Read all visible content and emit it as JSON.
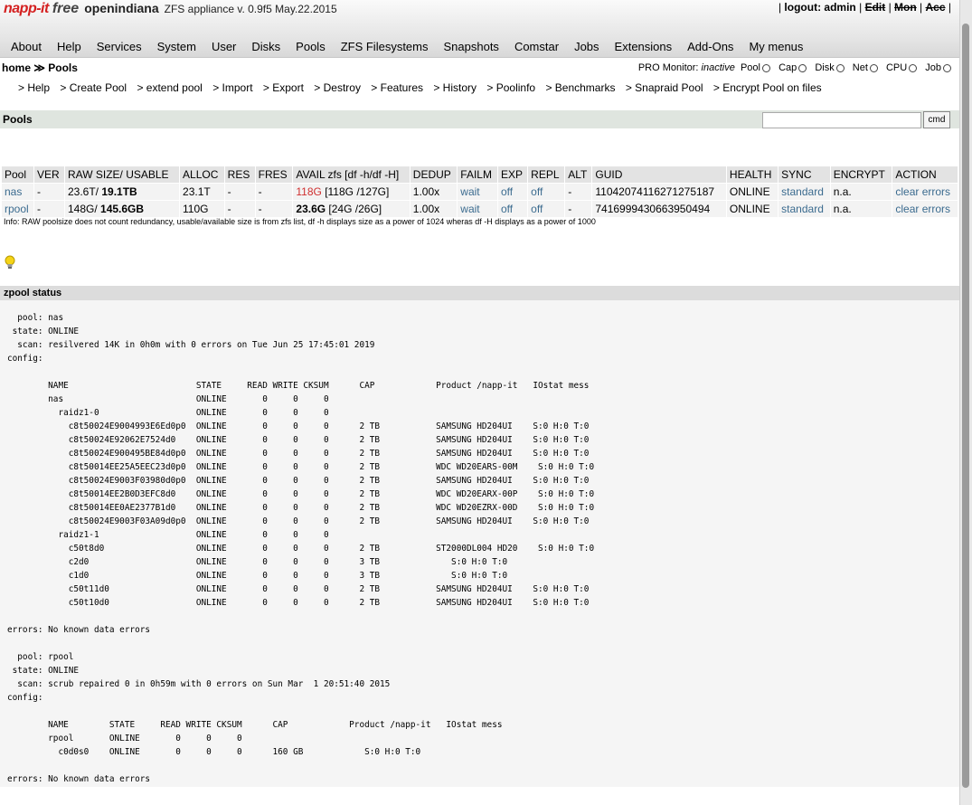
{
  "brand": {
    "logo": "napp-it",
    "free": "free",
    "os": "openindiana",
    "version": "ZFS appliance v. 0.9f5 May.22.2015"
  },
  "userbar": {
    "sep1": "|",
    "logout": "logout: admin",
    "sep2": "|",
    "edit": "Edit",
    "sep3": "|",
    "mon": "Mon",
    "sep4": "|",
    "acc": "Acc",
    "sep5": "|"
  },
  "mainnav": [
    "About",
    "Help",
    "Services",
    "System",
    "User",
    "Disks",
    "Pools",
    "ZFS Filesystems",
    "Snapshots",
    "Comstar",
    "Jobs",
    "Extensions",
    "Add-Ons",
    "My menus"
  ],
  "breadcrumb": "home ≫ Pools",
  "monitor": {
    "label": "PRO Monitor:",
    "state": "inactive",
    "items": [
      "Pool",
      "Cap",
      "Disk",
      "Net",
      "CPU",
      "Job"
    ]
  },
  "subnav": [
    "> Help",
    "> Create Pool",
    "> extend pool",
    "> Import",
    "> Export",
    "> Destroy",
    "> Features",
    "> History",
    "> Poolinfo",
    "> Benchmarks",
    "> Snapraid Pool",
    "> Encrypt Pool on files"
  ],
  "section_pools": "Pools",
  "cmd_label": "cmd",
  "pools_table": {
    "headers": [
      "Pool",
      "VER",
      "RAW SIZE/ USABLE",
      "ALLOC",
      "RES",
      "FRES",
      "AVAIL zfs [df -h/df -H]",
      "DEDUP",
      "FAILM",
      "EXP",
      "REPL",
      "ALT",
      "GUID",
      "HEALTH",
      "SYNC",
      "ENCRYPT",
      "ACTION"
    ],
    "rows": [
      {
        "pool": "nas",
        "ver": "-",
        "raw": "23.6T/ ",
        "usable": "19.1TB",
        "alloc": "23.1T",
        "res": "-",
        "fres": "-",
        "avail": "118G",
        "avail_df": " [118G /127G]",
        "dedup": "1.00x",
        "failm": "wait",
        "exp": "off",
        "repl": "off",
        "alt": "-",
        "guid": "11042074116271275187",
        "health": "ONLINE",
        "sync": "standard",
        "encrypt": "n.a.",
        "action": "clear errors"
      },
      {
        "pool": "rpool",
        "ver": "-",
        "raw": "148G/ ",
        "usable": "145.6GB",
        "alloc": "110G",
        "res": "-",
        "fres": "-",
        "avail": "23.6G",
        "avail_df": " [24G /26G]",
        "dedup": "1.00x",
        "failm": "wait",
        "exp": "off",
        "repl": "off",
        "alt": "-",
        "guid": "7416999430663950494",
        "health": "ONLINE",
        "sync": "standard",
        "encrypt": "n.a.",
        "action": "clear errors"
      }
    ]
  },
  "info": "Info: RAW poolsize does not count redundancy, usable/available size is from zfs list, df -h displays size as a power of 1024 wheras df -H displays as a power of 1000",
  "section_zpool": "zpool status",
  "zpool_status": "  pool: nas\n state: ONLINE\n  scan: resilvered 14K in 0h0m with 0 errors on Tue Jun 25 17:45:01 2019\nconfig:\n\n        NAME                         STATE     READ WRITE CKSUM      CAP            Product /napp-it   IOstat mess\n        nas                          ONLINE       0     0     0\n          raidz1-0                   ONLINE       0     0     0\n            c8t50024E9004993E6Ed0p0  ONLINE       0     0     0      2 TB           SAMSUNG HD204UI    S:0 H:0 T:0\n            c8t50024E92062E7524d0    ONLINE       0     0     0      2 TB           SAMSUNG HD204UI    S:0 H:0 T:0\n            c8t50024E900495BE84d0p0  ONLINE       0     0     0      2 TB           SAMSUNG HD204UI    S:0 H:0 T:0\n            c8t50014EE25A5EEC23d0p0  ONLINE       0     0     0      2 TB           WDC WD20EARS-00M    S:0 H:0 T:0\n            c8t50024E9003F03980d0p0  ONLINE       0     0     0      2 TB           SAMSUNG HD204UI    S:0 H:0 T:0\n            c8t50014EE2B0D3EFC8d0    ONLINE       0     0     0      2 TB           WDC WD20EARX-00P    S:0 H:0 T:0\n            c8t50014EE0AE2377B1d0    ONLINE       0     0     0      2 TB           WDC WD20EZRX-00D    S:0 H:0 T:0\n            c8t50024E9003F03A09d0p0  ONLINE       0     0     0      2 TB           SAMSUNG HD204UI    S:0 H:0 T:0\n          raidz1-1                   ONLINE       0     0     0\n            c50t8d0                  ONLINE       0     0     0      2 TB           ST2000DL004 HD20    S:0 H:0 T:0\n            c2d0                     ONLINE       0     0     0      3 TB              S:0 H:0 T:0\n            c1d0                     ONLINE       0     0     0      3 TB              S:0 H:0 T:0\n            c50t11d0                 ONLINE       0     0     0      2 TB           SAMSUNG HD204UI    S:0 H:0 T:0\n            c50t10d0                 ONLINE       0     0     0      2 TB           SAMSUNG HD204UI    S:0 H:0 T:0\n\nerrors: No known data errors\n\n  pool: rpool\n state: ONLINE\n  scan: scrub repaired 0 in 0h59m with 0 errors on Sun Mar  1 20:51:40 2015\nconfig:\n\n        NAME        STATE     READ WRITE CKSUM      CAP            Product /napp-it   IOstat mess\n        rpool       ONLINE       0     0     0\n          c0d0s0    ONLINE       0     0     0      160 GB            S:0 H:0 T:0\n\nerrors: No known data errors"
}
